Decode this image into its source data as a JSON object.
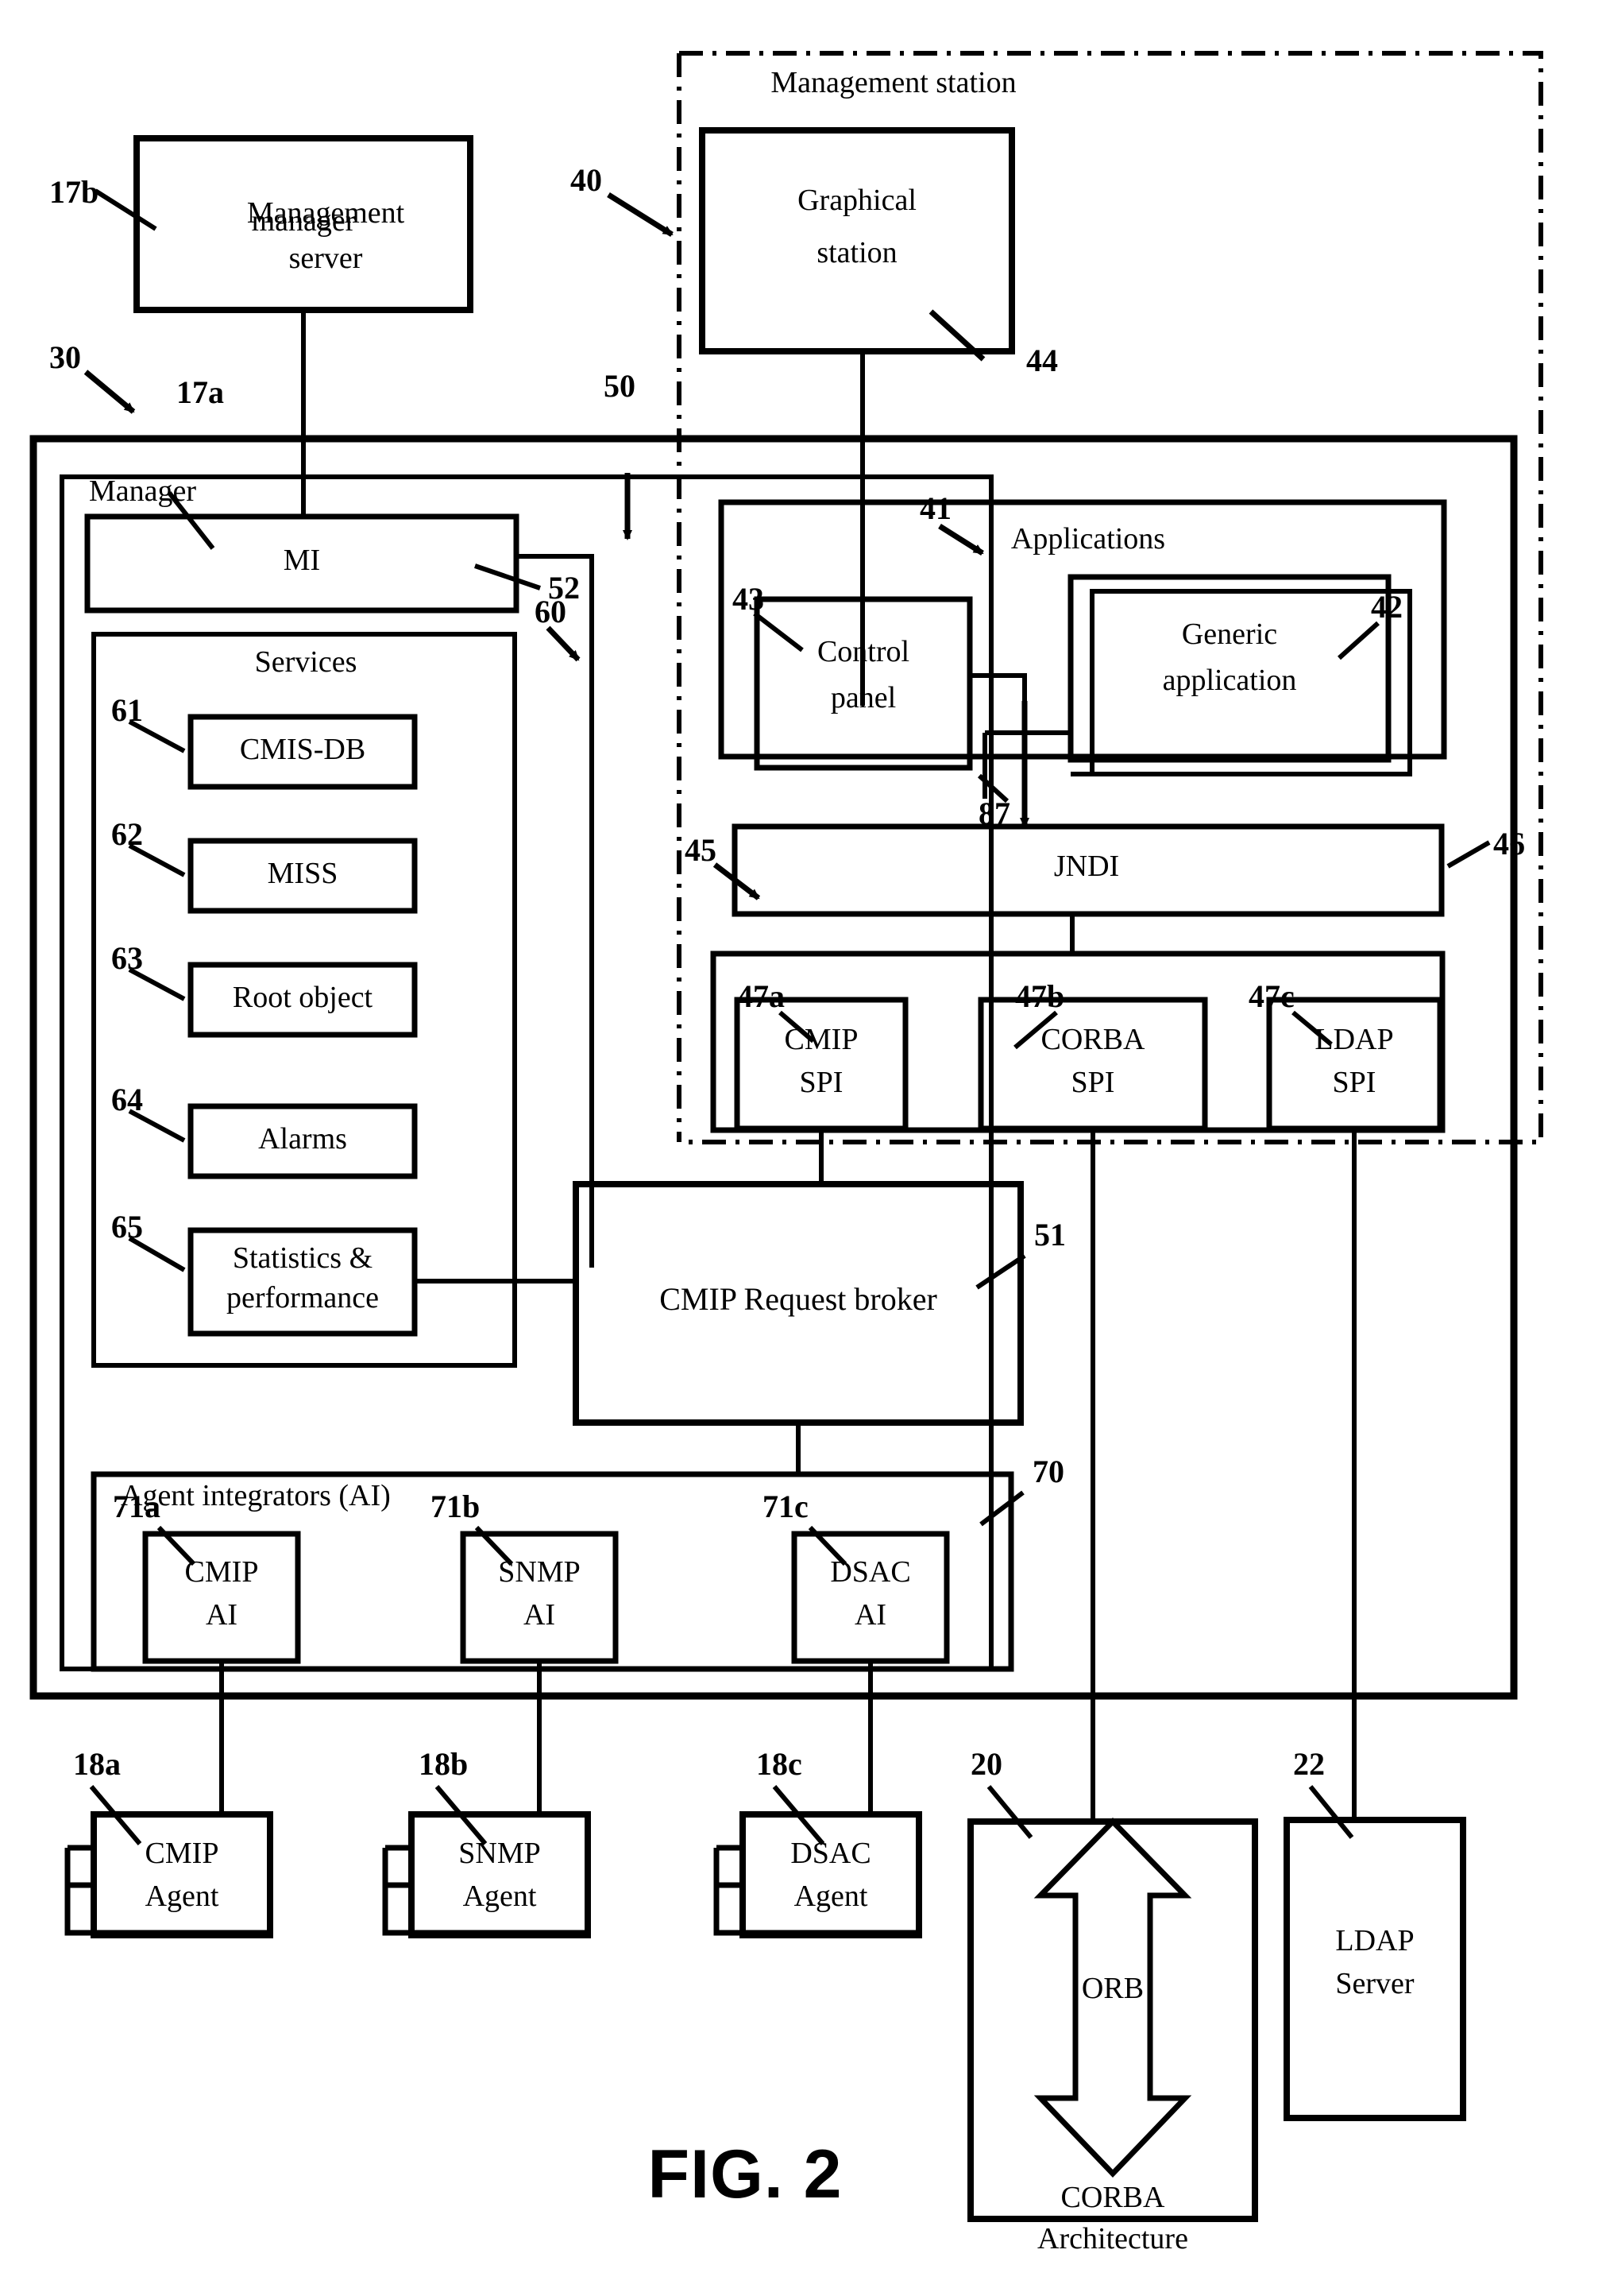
{
  "figure": {
    "caption": "FIG. 2",
    "title_text": "FIG. 2"
  },
  "regions": {
    "management_station": {
      "label": "Management station",
      "ref": "40"
    },
    "management_server": {
      "label_line1": "Management",
      "label_line2": "server",
      "ref": "30"
    },
    "manager_inner": {
      "label": "Manager",
      "ref": "17a"
    },
    "services": {
      "label": "Services",
      "ref": "60"
    },
    "applications": {
      "label": "Applications",
      "ref": "41"
    },
    "agent_integrators": {
      "label": "Agent integrators (AI)",
      "ref": "70"
    },
    "spi_group": {
      "ref": "45"
    },
    "bus_50": {
      "ref": "50"
    }
  },
  "boxes": {
    "manager_top": {
      "label": "manager",
      "ref": "17b"
    },
    "graphical_station": {
      "line1": "Graphical",
      "line2": "station",
      "ref": "44"
    },
    "mi": {
      "label": "MI",
      "ref": "52"
    },
    "cmis_db": {
      "label": "CMIS-DB",
      "ref": "61"
    },
    "miss": {
      "label": "MISS",
      "ref": "62"
    },
    "root_object": {
      "label": "Root object",
      "ref": "63"
    },
    "alarms": {
      "label": "Alarms",
      "ref": "64"
    },
    "statistics": {
      "line1": "Statistics &",
      "line2": "performance",
      "ref": "65"
    },
    "control_panel": {
      "line1": "Control",
      "line2": "panel",
      "ref": "43"
    },
    "generic_application": {
      "line1": "Generic",
      "line2": "application",
      "ref": "42"
    },
    "jndi": {
      "label": "JNDI",
      "ref": "46"
    },
    "cmip_spi": {
      "line1": "CMIP",
      "line2": "SPI",
      "ref": "47a"
    },
    "corba_spi": {
      "line1": "CORBA",
      "line2": "SPI",
      "ref": "47b"
    },
    "ldap_spi": {
      "line1": "LDAP",
      "line2": "SPI",
      "ref": "47c"
    },
    "cmip_request_broker": {
      "label": "CMIP Request broker",
      "ref": "51"
    },
    "cmip_ai": {
      "line1": "CMIP",
      "line2": "AI",
      "ref": "71a"
    },
    "snmp_ai": {
      "line1": "SNMP",
      "line2": "AI",
      "ref": "71b"
    },
    "dsac_ai": {
      "line1": "DSAC",
      "line2": "AI",
      "ref": "71c"
    },
    "cmip_agent": {
      "line1": "CMIP",
      "line2": "Agent",
      "ref": "18a"
    },
    "snmp_agent": {
      "line1": "SNMP",
      "line2": "Agent",
      "ref": "18b"
    },
    "dsac_agent": {
      "line1": "DSAC",
      "line2": "Agent",
      "ref": "18c"
    },
    "corba_architecture": {
      "orb": "ORB",
      "line1": "CORBA",
      "line2": "Architecture",
      "ref": "20"
    },
    "ldap_server": {
      "line1": "LDAP",
      "line2": "Server",
      "ref": "22"
    }
  },
  "connector_refs": {
    "app_to_jndi": "87"
  },
  "colors": {
    "ink": "#000000",
    "paper": "#ffffff"
  }
}
